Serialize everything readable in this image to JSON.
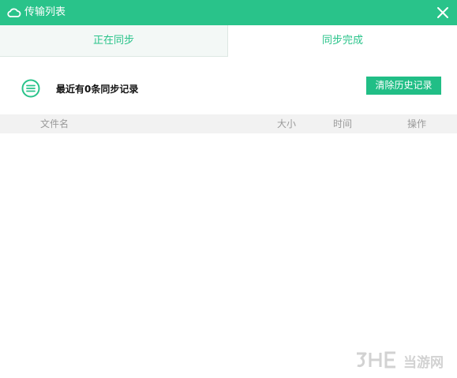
{
  "window": {
    "title": "传输列表",
    "title_icon": "cloud-icon",
    "close_icon": "close-icon",
    "accent_color": "#29c38a"
  },
  "tabs": [
    {
      "label": "正在同步",
      "active": false
    },
    {
      "label": "同步完成",
      "active": true
    }
  ],
  "summary": {
    "icon": "list-icon",
    "text": "最近有0条同步记录",
    "clear_button_label": "清除历史记录"
  },
  "table": {
    "columns": [
      "文件名",
      "大小",
      "时间",
      "操作"
    ],
    "rows": []
  },
  "watermark": {
    "logo": "3DM",
    "text": "当游网"
  }
}
